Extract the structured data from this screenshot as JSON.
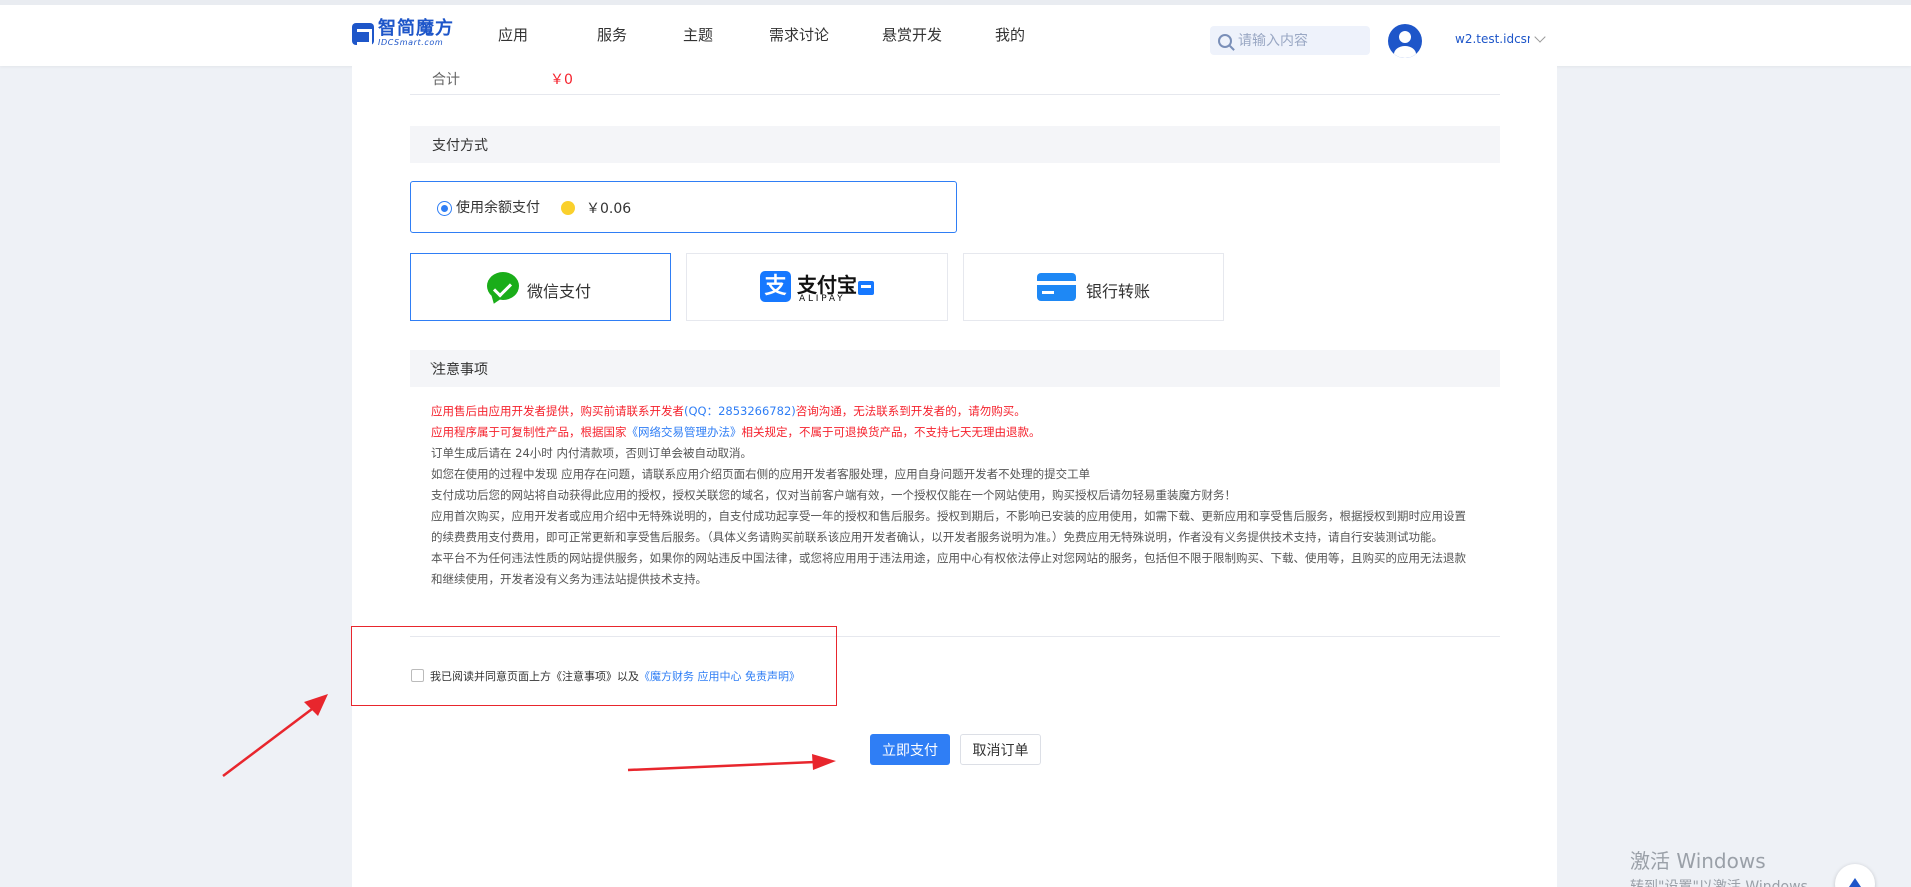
{
  "header": {
    "logo_cn": "智简魔方",
    "logo_en": "IDCSmart.com",
    "nav": [
      "应用",
      "服务",
      "主题",
      "需求讨论",
      "悬赏开发",
      "我的"
    ],
    "search_placeholder": "请输入内容",
    "username": "w2.test.idcsmart"
  },
  "order": {
    "total_label": "合计",
    "total_value": "￥0"
  },
  "payment": {
    "section_title": "支付方式",
    "balance_label": "使用余额支付",
    "balance_amount": "￥0.06",
    "methods": {
      "wechat": "微信支付",
      "alipay_cn": "支付宝",
      "alipay_en": "ALIPAY",
      "alipay_glyph": "支",
      "bank": "银行转账"
    }
  },
  "notice": {
    "title": "注意事项",
    "line1_a": "应用售后由应用开发者提供，购买前请联系开发者",
    "line1_qq": "(QQ：2853266782)",
    "line1_b": "咨询沟通，无法联系到开发者的，请勿购买。",
    "line2_a": "应用程序属于可复制性产品，根据国家",
    "line2_law": "《网络交易管理办法》",
    "line2_b": "相关规定，不属于可退换货产品，不支持七天无理由退款。",
    "lines": [
      "订单生成后请在 24小时 内付清款项，否则订单会被自动取消。",
      "如您在使用的过程中发现 应用存在问题，请联系应用介绍页面右侧的应用开发者客服处理，应用自身问题开发者不处理的提交工单",
      "支付成功后您的网站将自动获得此应用的授权，授权关联您的域名，仅对当前客户端有效，一个授权仅能在一个网站使用，购买授权后请勿轻易重装魔方财务！",
      "应用首次购买，应用开发者或应用介绍中无特殊说明的，自支付成功起享受一年的授权和售后服务。授权到期后，不影响已安装的应用使用，如需下载、更新应用和享受售后服务，根据授权到期时应用设置的续费费用支付费用，即可正常更新和享受售后服务。（具体义务请购买前联系该应用开发者确认，以开发者服务说明为准。）免费应用无特殊说明，作者没有义务提供技术支持，请自行安装测试功能。",
      "本平台不为任何违法性质的网站提供服务，如果你的网站违反中国法律，或您将应用用于违法用途，应用中心有权依法停止对您网站的服务，包括但不限于限制购买、下载、使用等，且购买的应用无法退款和继续使用，开发者没有义务为违法站提供技术支持。"
    ]
  },
  "agreement": {
    "text": "我已阅读并同意页面上方《注意事项》以及",
    "link": "《魔方财务 应用中心 免责声明》"
  },
  "actions": {
    "pay": "立即支付",
    "cancel": "取消订单"
  },
  "watermark": {
    "title": "激活 Windows",
    "subtitle": "转到\"设置\"以激活 Windows。"
  },
  "colors": {
    "brand": "#1e56c9",
    "accent": "#2f7ef5",
    "price": "#f5222d",
    "annotation": "#e8262d"
  }
}
